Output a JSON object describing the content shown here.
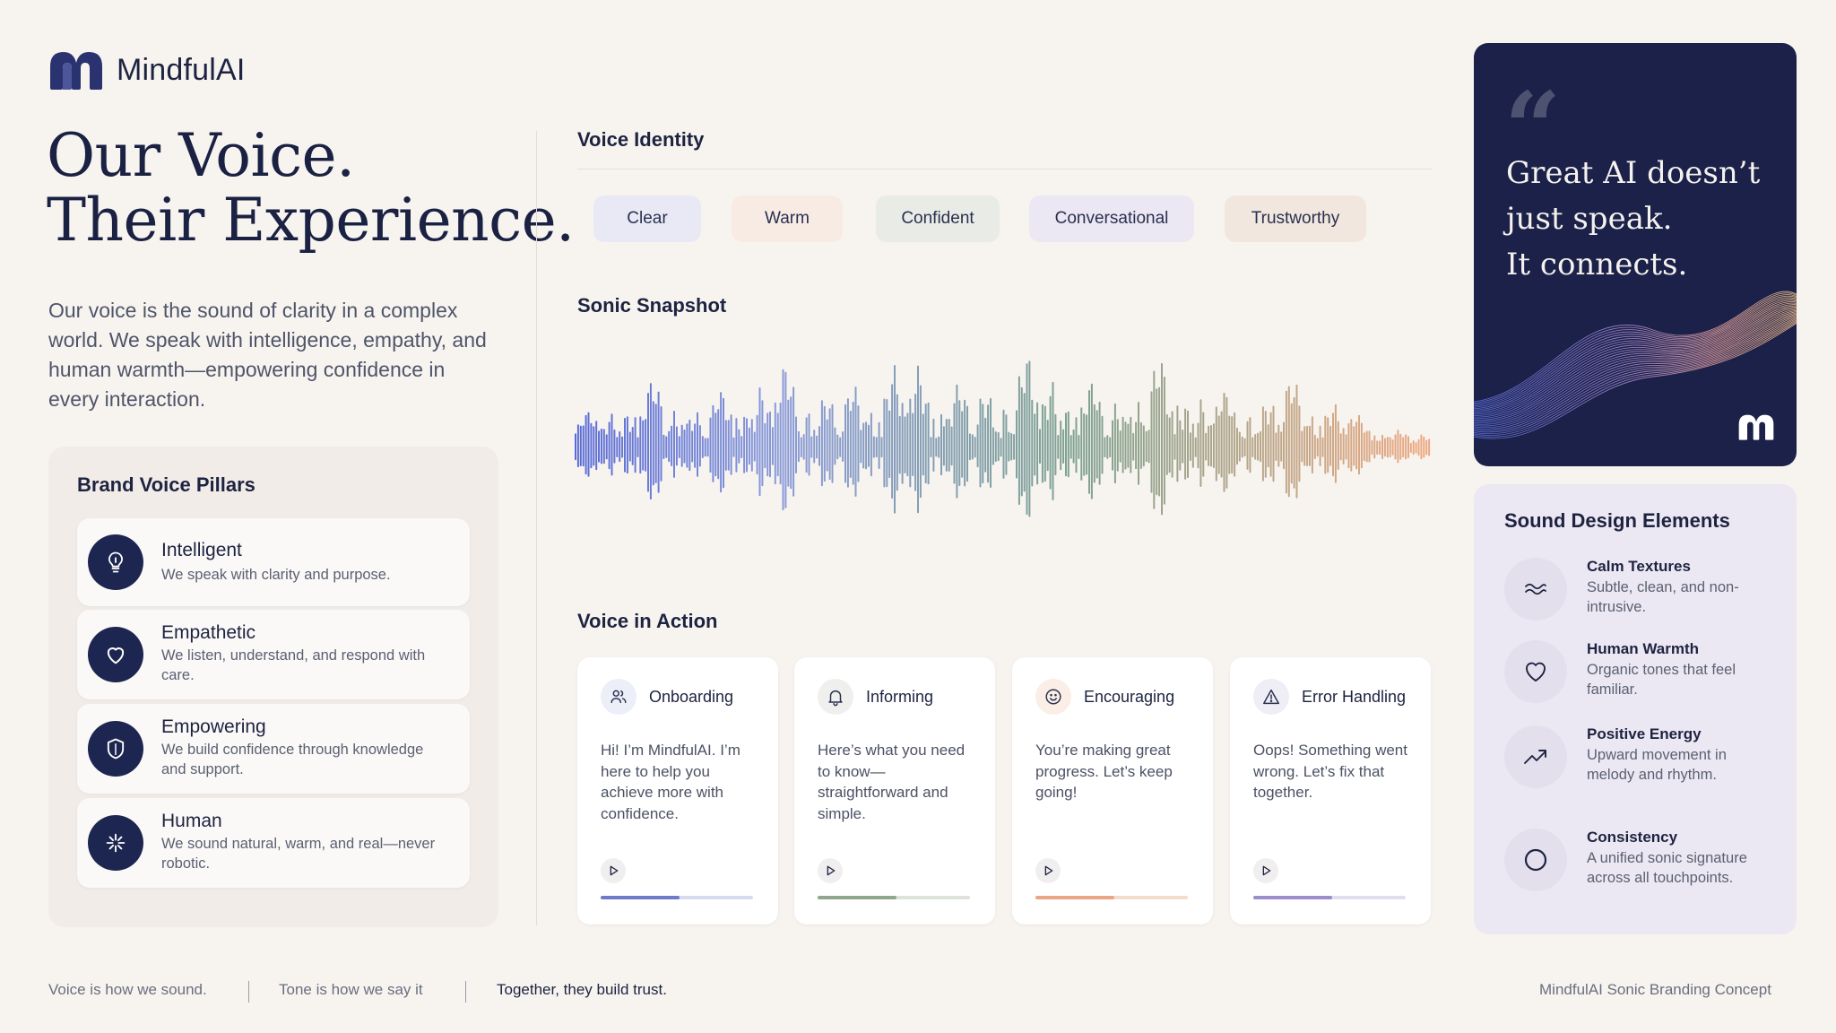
{
  "brand": {
    "name": "MindfulAI"
  },
  "hero": {
    "headline_line1": "Our Voice.",
    "headline_line2": "Their Experience.",
    "intro": "Our voice is the sound of clarity in a complex world. We speak with intelligence, empathy, and human warmth—empowering confidence in every interaction."
  },
  "pillars": {
    "title": "Brand Voice Pillars",
    "items": [
      {
        "title": "Intelligent",
        "desc": "We speak with clarity and purpose.",
        "icon": "lightbulb-icon"
      },
      {
        "title": "Empathetic",
        "desc": "We listen, understand, and respond with care.",
        "icon": "heart-icon"
      },
      {
        "title": "Empowering",
        "desc": "We build confidence through knowledge and support.",
        "icon": "shield-icon"
      },
      {
        "title": "Human",
        "desc": "We sound natural, warm, and real—never robotic.",
        "icon": "sparkle-icon"
      }
    ]
  },
  "voice_identity": {
    "title": "Voice Identity",
    "chips": [
      {
        "label": "Clear",
        "color": "#e9e9f6"
      },
      {
        "label": "Warm",
        "color": "#f8ebe4"
      },
      {
        "label": "Confident",
        "color": "#e9ece6"
      },
      {
        "label": "Conversational",
        "color": "#ebe7f3"
      },
      {
        "label": "Trustworthy",
        "color": "#f1e7de"
      }
    ]
  },
  "sonic_snapshot": {
    "title": "Sonic Snapshot",
    "gradient": [
      "#5a6bd6",
      "#8a9ad8",
      "#7fa291",
      "#f0a982"
    ]
  },
  "voice_in_action": {
    "title": "Voice in Action",
    "cards": [
      {
        "title": "Onboarding",
        "icon": "users-icon",
        "text": "Hi! I’m MindfulAI. I’m here to help you achieve more with confidence.",
        "progress": 0.52,
        "accent": "#6f7ac9",
        "track": "#d7dbef",
        "icon_bg": "#eceef8"
      },
      {
        "title": "Informing",
        "icon": "bell-icon",
        "text": "Here’s what you need to know—straightforward and simple.",
        "progress": 0.52,
        "accent": "#8fa78c",
        "track": "#dde3da",
        "icon_bg": "#efefed"
      },
      {
        "title": "Encouraging",
        "icon": "smile-icon",
        "text": "You’re making great progress. Let’s keep going!",
        "progress": 0.52,
        "accent": "#eba582",
        "track": "#f4dccd",
        "icon_bg": "#fbeee6"
      },
      {
        "title": "Error Handling",
        "icon": "warning-icon",
        "text": "Oops! Something went wrong. Let’s fix that together.",
        "progress": 0.52,
        "accent": "#9c8ec9",
        "track": "#e2def0",
        "icon_bg": "#efedf5"
      }
    ]
  },
  "quote": {
    "line1": "Great AI doesn’t",
    "line2": "just speak.",
    "line3": "It connects."
  },
  "sound_design": {
    "title": "Sound Design Elements",
    "items": [
      {
        "name": "Calm Textures",
        "desc": "Subtle, clean, and non-intrusive.",
        "icon": "waves-icon"
      },
      {
        "name": "Human Warmth",
        "desc": "Organic tones that feel familiar.",
        "icon": "heart-icon"
      },
      {
        "name": "Positive Energy",
        "desc": "Upward movement in melody and rhythm.",
        "icon": "trend-up-icon"
      },
      {
        "name": "Consistency",
        "desc": "A unified sonic signature across all touchpoints.",
        "icon": "circle-icon"
      }
    ]
  },
  "footer": {
    "left1": "Voice is how we sound.",
    "left2": "Tone is how we say it",
    "left3": "Together, they build trust.",
    "right": "MindfulAI Sonic Branding Concept"
  }
}
